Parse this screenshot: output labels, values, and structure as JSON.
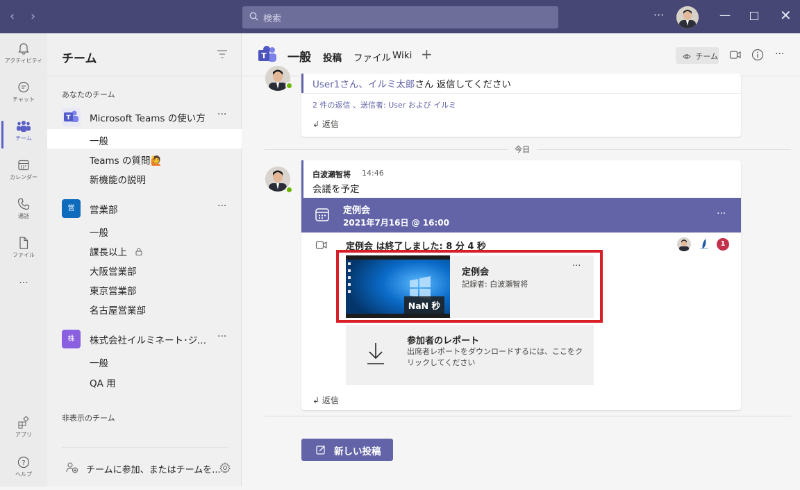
{
  "title_bar": {
    "search_placeholder": "検索",
    "more": "···"
  },
  "rail": {
    "items": [
      {
        "label": "アクティビティ",
        "icon": "bell-icon"
      },
      {
        "label": "チャット",
        "icon": "chat-icon"
      },
      {
        "label": "チーム",
        "icon": "teams-icon"
      },
      {
        "label": "カレンダー",
        "icon": "calendar-icon"
      },
      {
        "label": "通話",
        "icon": "phone-icon"
      },
      {
        "label": "ファイル",
        "icon": "file-icon"
      }
    ],
    "more": "···",
    "apps_label": "アプリ",
    "help_label": "ヘルプ"
  },
  "teams_pane": {
    "title": "チーム",
    "your_teams": "あなたのチーム",
    "teams": [
      {
        "logo": "",
        "name": "Microsoft Teams の使い方",
        "color": "#5b5fc7",
        "channels": [
          "一般",
          "Teams の質問🙋",
          "新機能の説明"
        ]
      },
      {
        "logo": "営",
        "name": "営業部",
        "color": "#0f6cbd",
        "channels": [
          "一般",
          "課長以上",
          "大阪営業部",
          "東京営業部",
          "名古屋営業部"
        ]
      },
      {
        "logo": "株",
        "name": "株式会社イルミネート･ジャパ...",
        "color": "#8a5fe0",
        "channels": [
          "一般",
          "QA 用"
        ]
      }
    ],
    "hidden_teams": "非表示のチーム",
    "join_text": "チームに参加、またはチームを...",
    "more": "···"
  },
  "channel_header": {
    "name": "一般",
    "tabs": [
      "投稿",
      "ファイル",
      "Wiki"
    ],
    "add": "+",
    "team_chip": "チーム"
  },
  "messages": {
    "prev_line_prefix": "User1さん、",
    "prev_line_link": "イルミ太郎",
    "prev_line_suffix": "さん 返信してください",
    "prev_replies": "2 件の返信 、送信者: User および イルミ",
    "reply": "返信",
    "day": "今日",
    "author": "白波瀬智将",
    "time": "14:46",
    "body": "会議を予定",
    "event_name": "定例会",
    "event_date": "2021年7月16日 @ 16:00",
    "event_ended": "定例会 は終了しました: 8 分 4 秒",
    "attendee_count": "1",
    "recording_title": "定例会",
    "recording_by": "記録者: 白波瀬智将",
    "duration": "NaN 秒",
    "report_title": "参加者のレポート",
    "report_desc": "出席者レポートをダウンロードするには、ここをクリックしてください",
    "more": "···"
  },
  "new_post": "新しい投稿",
  "colors": {
    "brand": "#6264a7",
    "highlight": "#d81e26"
  }
}
